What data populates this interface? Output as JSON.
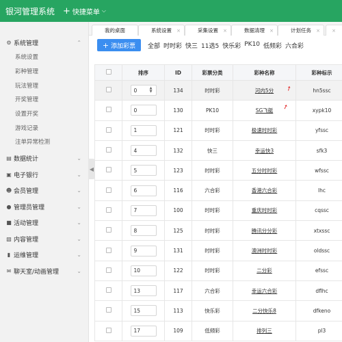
{
  "app": {
    "title": "银河管理系统",
    "quick_menu": "快捷菜单"
  },
  "sidebar": {
    "groups": [
      {
        "label": "系统管理",
        "icon": "gear-icon",
        "expanded": true,
        "children": [
          "系统设置",
          "彩种管理",
          "玩法管理",
          "开奖管理",
          "设置开奖",
          "游戏记录",
          "注单异常检测"
        ]
      },
      {
        "label": "数据统计",
        "icon": "bar-chart-icon"
      },
      {
        "label": "电子银行",
        "icon": "bank-card-icon"
      },
      {
        "label": "会员管理",
        "icon": "user-icon"
      },
      {
        "label": "管理员管理",
        "icon": "admin-icon"
      },
      {
        "label": "活动管理",
        "icon": "gift-icon"
      },
      {
        "label": "内容管理",
        "icon": "folder-icon"
      },
      {
        "label": "运维管理",
        "icon": "wrench-icon"
      },
      {
        "label": "聊天室/动画管理",
        "icon": "chat-icon"
      }
    ]
  },
  "tabs": [
    "我的桌面",
    "系统设置",
    "采集设置",
    "数据清理",
    "计划任务"
  ],
  "toolbar": {
    "add_label": "添加彩票",
    "filters": [
      "全部",
      "时时彩",
      "快三",
      "11选5",
      "快乐彩",
      "PK10",
      "低频彩",
      "六合彩"
    ]
  },
  "table": {
    "headers": [
      "排序",
      "ID",
      "彩票分类",
      "彩种名称",
      "彩种标示"
    ],
    "rows": [
      {
        "sort": "0",
        "id": "134",
        "category": "时时彩",
        "name": "河内5分",
        "code": "hn5ssc"
      },
      {
        "sort": "0",
        "id": "130",
        "category": "PK10",
        "name": "SG飞艇",
        "code": "xypk10"
      },
      {
        "sort": "1",
        "id": "121",
        "category": "时时彩",
        "name": "极速时时彩",
        "code": "yfssc"
      },
      {
        "sort": "4",
        "id": "132",
        "category": "快三",
        "name": "幸运快3",
        "code": "sfk3"
      },
      {
        "sort": "5",
        "id": "123",
        "category": "时时彩",
        "name": "五分时时彩",
        "code": "wfssc"
      },
      {
        "sort": "6",
        "id": "116",
        "category": "六合彩",
        "name": "香港六合彩",
        "code": "lhc"
      },
      {
        "sort": "7",
        "id": "100",
        "category": "时时彩",
        "name": "重庆时时彩",
        "code": "cqssc"
      },
      {
        "sort": "8",
        "id": "125",
        "category": "时时彩",
        "name": "腾讯分分彩",
        "code": "xtxssc"
      },
      {
        "sort": "9",
        "id": "131",
        "category": "时时彩",
        "name": "澳洲时时彩",
        "code": "oldssc"
      },
      {
        "sort": "10",
        "id": "122",
        "category": "时时彩",
        "name": "二分彩",
        "code": "efssc"
      },
      {
        "sort": "13",
        "id": "117",
        "category": "六合彩",
        "name": "幸运六合彩",
        "code": "dflhc"
      },
      {
        "sort": "15",
        "id": "113",
        "category": "快乐彩",
        "name": "二分快乐8",
        "code": "dfkeno"
      },
      {
        "sort": "17",
        "id": "109",
        "category": "低频彩",
        "name": "排列三",
        "code": "pl3"
      }
    ]
  },
  "colors": {
    "header_bg": "#27a561",
    "add_button": "#3b8ef0",
    "annotation_arrow": "#e02020"
  }
}
